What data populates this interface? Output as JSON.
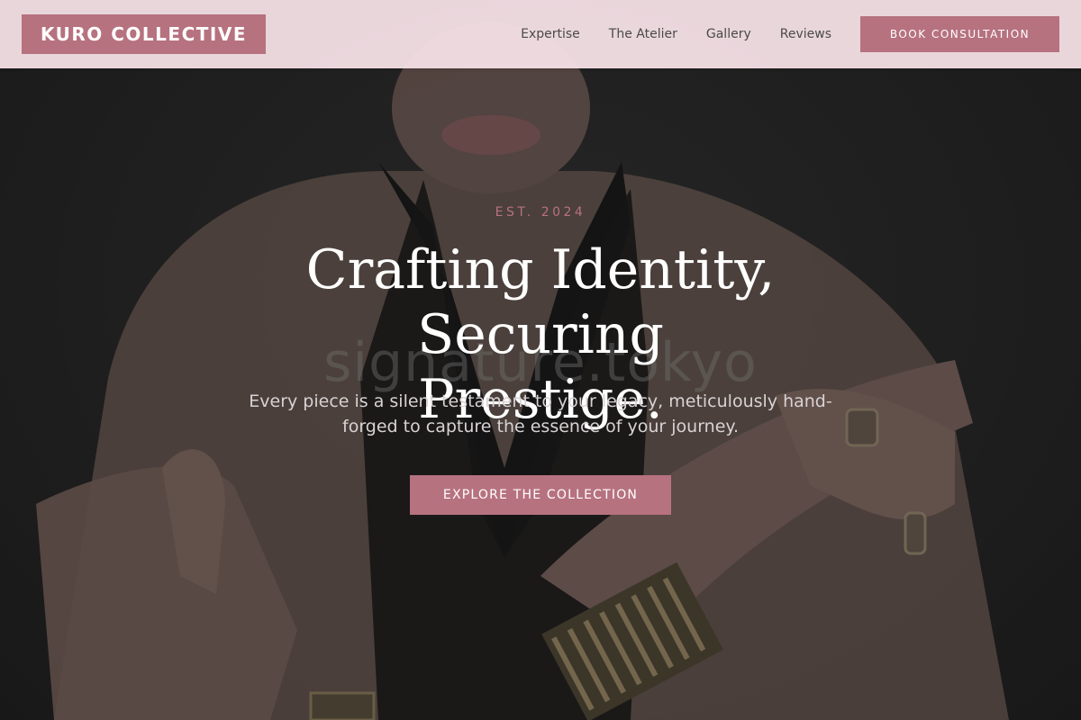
{
  "colors": {
    "accent": "#b7727f",
    "header_bg": "#f6e2e8",
    "hero_bg": "#232323",
    "nav_text": "#4a4a4a",
    "headline_text": "#ffffff",
    "subtext": "#d8d2d4"
  },
  "header": {
    "logo_text": "KURO COLLECTIVE",
    "nav": [
      {
        "label": "Expertise"
      },
      {
        "label": "The Atelier"
      },
      {
        "label": "Gallery"
      },
      {
        "label": "Reviews"
      }
    ],
    "cta_label": "BOOK CONSULTATION"
  },
  "hero": {
    "eyebrow": "EST. 2024",
    "headline_line1": "Crafting Identity, Securing",
    "headline_line2": "Prestige.",
    "watermark": "signature.tokyo",
    "subtext": "Every piece is a silent testament to your legacy, meticulously hand-forged to capture the essence of your journey.",
    "cta_label": "EXPLORE THE COLLECTION"
  }
}
